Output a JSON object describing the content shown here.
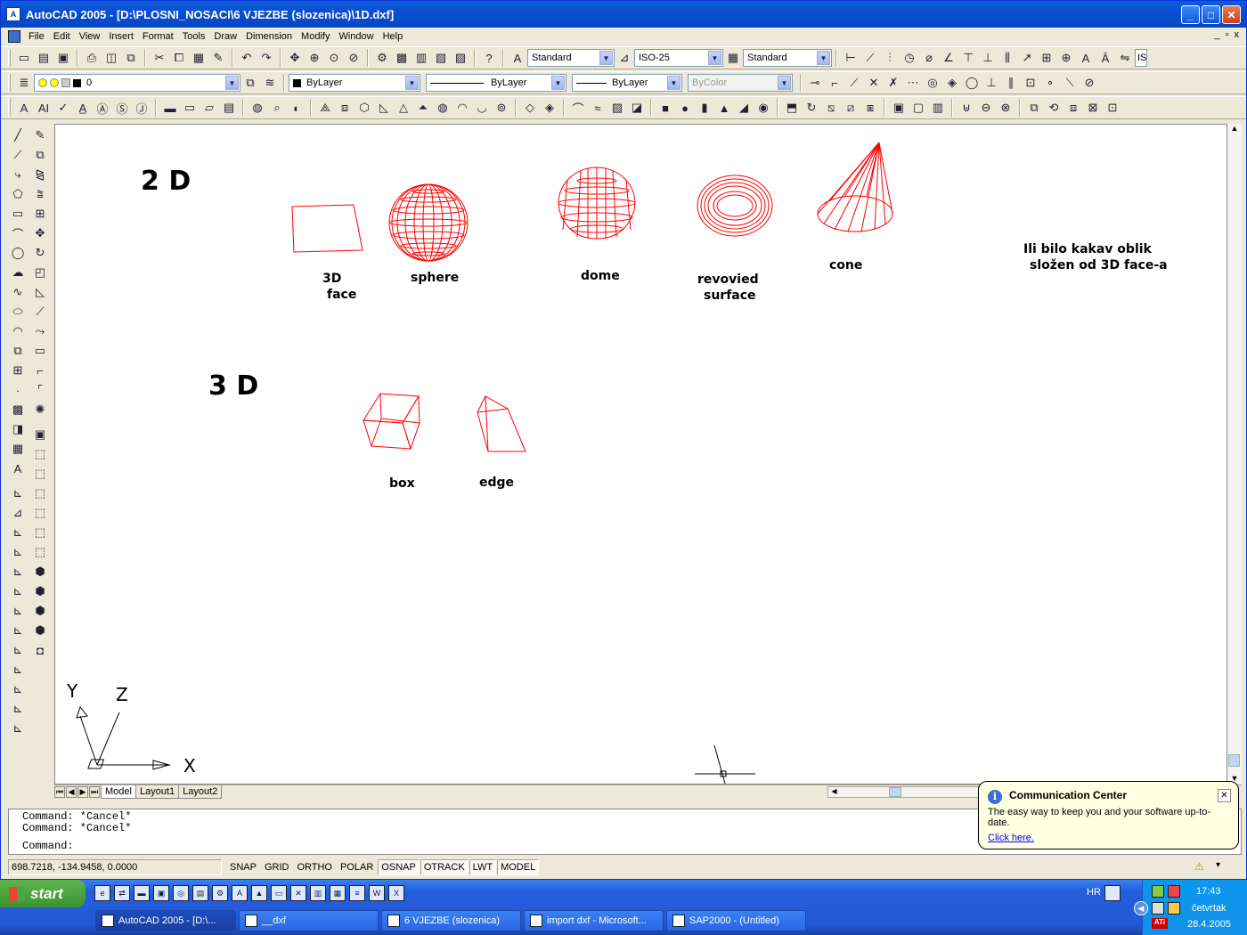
{
  "window": {
    "title": "AutoCAD 2005 - [D:\\PLOSNI_NOSACI\\6 VJEZBE (slozenica)\\1D.dxf]",
    "app_icon": "autocad-icon",
    "minimize": "_",
    "maximize": "□",
    "close": "✕"
  },
  "menubar": {
    "items": [
      "File",
      "Edit",
      "View",
      "Insert",
      "Format",
      "Tools",
      "Draw",
      "Dimension",
      "Modify",
      "Window",
      "Help"
    ],
    "mdi_min": "_",
    "mdi_restore": "▫",
    "mdi_close": "x"
  },
  "toolbars": {
    "text_style": "Standard",
    "dim_style": "ISO-25",
    "table_style": "Standard",
    "clipped_combo": "IS",
    "layer": "0",
    "color": "ByLayer",
    "linetype": "ByLayer",
    "lineweight": "ByLayer",
    "plotstyle": "ByColor"
  },
  "drawing": {
    "labels": {
      "two_d": "2 D",
      "three_d": "3 D",
      "face_line1": "3D",
      "face_line2": "face",
      "sphere": "sphere",
      "dome": "dome",
      "revolved_line1": "revovied",
      "revolved_line2": "surface",
      "cone": "cone",
      "note_line1": "Ili bilo kakav oblik",
      "note_line2": "složen od 3D face-a",
      "box": "box",
      "wedge": "edge"
    },
    "ucs": {
      "x": "X",
      "y": "Y",
      "z": "Z"
    },
    "accent": "#ff0000"
  },
  "layout_tabs": [
    "Model",
    "Layout1",
    "Layout2"
  ],
  "command": {
    "lines": [
      "Command:  *Cancel*",
      "Command:  *Cancel*"
    ],
    "prompt": "Command:"
  },
  "status": {
    "coords": "698.7218, -134.9458, 0.0000",
    "toggles": [
      {
        "label": "SNAP",
        "on": false
      },
      {
        "label": "GRID",
        "on": false
      },
      {
        "label": "ORTHO",
        "on": false
      },
      {
        "label": "POLAR",
        "on": false
      },
      {
        "label": "OSNAP",
        "on": true
      },
      {
        "label": "OTRACK",
        "on": true
      },
      {
        "label": "LWT",
        "on": true
      },
      {
        "label": "MODEL",
        "on": true
      }
    ]
  },
  "balloon": {
    "title": "Communication Center",
    "body": "The easy way to keep you and your software up-to-date.",
    "link": "Click here."
  },
  "taskbar": {
    "start": "start",
    "language": "HR",
    "tasks": [
      {
        "label": "AutoCAD 2005 - [D:\\...",
        "active": true
      },
      {
        "label": "__dxf",
        "active": false
      },
      {
        "label": "6 VJEZBE (slozenica)",
        "active": false
      },
      {
        "label": "import dxf - Microsoft...",
        "active": false
      },
      {
        "label": "SAP2000 - (Untitled)",
        "active": false
      }
    ],
    "time": "17:43",
    "day": "četvrtak",
    "date": "28.4.2005"
  }
}
